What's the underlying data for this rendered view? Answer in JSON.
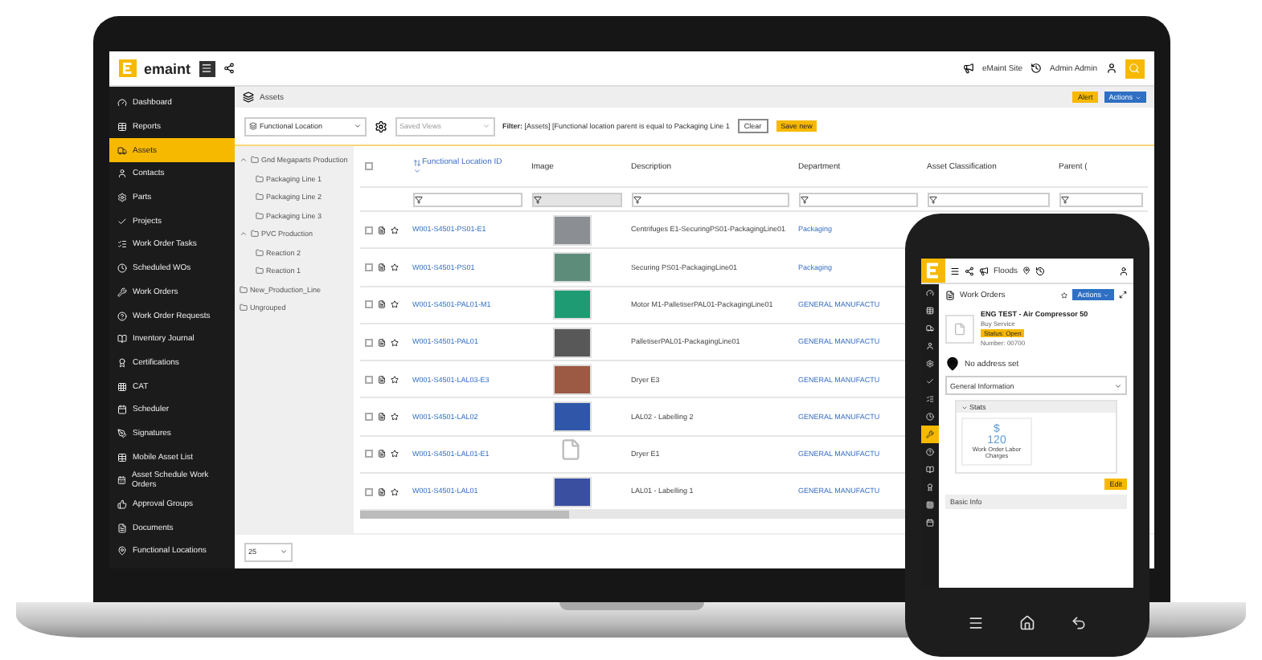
{
  "app": {
    "logo": "emaint",
    "site": "eMaint Site",
    "user": "Admin Admin"
  },
  "sidebar": [
    {
      "label": "Dashboard",
      "selected": false
    },
    {
      "label": "Reports",
      "selected": false
    },
    {
      "label": "Assets",
      "selected": true
    },
    {
      "label": "Contacts",
      "selected": false
    },
    {
      "label": "Parts",
      "selected": false
    },
    {
      "label": "Projects",
      "selected": false
    },
    {
      "label": "Work Order Tasks",
      "selected": false
    },
    {
      "label": "Scheduled WOs",
      "selected": false
    },
    {
      "label": "Work Orders",
      "selected": false
    },
    {
      "label": "Work Order Requests",
      "selected": false
    },
    {
      "label": "Inventory Journal",
      "selected": false
    },
    {
      "label": "Certifications",
      "selected": false
    },
    {
      "label": "CAT",
      "selected": false
    },
    {
      "label": "Scheduler",
      "selected": false
    },
    {
      "label": "Signatures",
      "selected": false
    },
    {
      "label": "Mobile Asset List",
      "selected": false
    },
    {
      "label": "Asset Schedule Work Orders",
      "selected": false
    },
    {
      "label": "Approval Groups",
      "selected": false
    },
    {
      "label": "Documents",
      "selected": false
    },
    {
      "label": "Functional Locations",
      "selected": false
    }
  ],
  "breadcrumb": "Assets",
  "page_buttons": {
    "alert": "Alert",
    "actions": "Actions"
  },
  "toolbar": {
    "view_select": "Functional Location",
    "saved_views_placeholder": "Saved Views",
    "filter": "**Filter:** [Assets] [Functional location parent is equal to Packaging Line 1",
    "clear": "Clear",
    "save": "Save new"
  },
  "tree": [
    {
      "label": "Gnd Megaparts Production",
      "expanded": true,
      "children": [
        {
          "label": "Packaging Line 1"
        },
        {
          "label": "Packaging Line 2"
        },
        {
          "label": "Packaging Line 3"
        }
      ]
    },
    {
      "label": "PVC Production",
      "expanded": true,
      "children": [
        {
          "label": "Reaction 2"
        },
        {
          "label": "Reaction 1"
        }
      ]
    },
    {
      "label": "New_Production_Line"
    },
    {
      "label": "Ungrouped"
    }
  ],
  "table": {
    "all_checked": false,
    "columns": [
      {
        "label": "Functional Location ID",
        "sorted": true
      },
      {
        "label": "Image",
        "sorted": false
      },
      {
        "label": "Description",
        "sorted": false
      },
      {
        "label": "Department",
        "sorted": false
      },
      {
        "label": "Asset Classification",
        "sorted": false
      },
      {
        "label": "Parent (",
        "sorted": false
      }
    ],
    "rows": [
      {
        "checked": false,
        "id": "W001-S4501-PS01-E1",
        "kind": "photo",
        "description": "Centrifuges E1-SecuringPS01-PackagingLine01",
        "department": "Packaging"
      },
      {
        "checked": false,
        "id": "W001-S4501-PS01",
        "kind": "photo",
        "description": "Securing PS01-PackagingLine01",
        "department": "Packaging"
      },
      {
        "checked": false,
        "id": "W001-S4501-PAL01-M1",
        "kind": "photo",
        "description": "Motor M1-PalletiserPAL01-PackagingLine01",
        "department": "GENERAL MANUFACTU"
      },
      {
        "checked": false,
        "id": "W001-S4501-PAL01",
        "kind": "photo",
        "description": "PalletiserPAL01-PackagingLine01",
        "department": "GENERAL MANUFACTU"
      },
      {
        "checked": false,
        "id": "W001-S4501-LAL03-E3",
        "kind": "photo",
        "description": "Dryer E3",
        "department": "GENERAL MANUFACTU"
      },
      {
        "checked": false,
        "id": "W001-S4501-LAL02",
        "kind": "photo",
        "description": "LAL02 - Labelling 2",
        "department": "GENERAL MANUFACTU"
      },
      {
        "checked": false,
        "id": "W001-S4501-LAL01-E1",
        "kind": "blank",
        "description": "Dryer E1",
        "department": "GENERAL MANUFACTU"
      },
      {
        "checked": false,
        "id": "W001-S4501-LAL01",
        "kind": "photo",
        "description": "LAL01 - Labelling 1",
        "department": "GENERAL MANUFACTU"
      }
    ]
  },
  "pagination": {
    "page_size": "25"
  },
  "phone": {
    "location": "Floods",
    "page_title": "Work Orders",
    "actions": "Actions",
    "record": {
      "title": "ENG TEST - Air Compressor 50",
      "subtitle": "Buy Service",
      "status": "Status: Open",
      "number": "Number: 00700"
    },
    "address": "No address set",
    "section_select": "General Information",
    "stats_title": "Stats",
    "stat": {
      "currency": "$",
      "value": "120",
      "label": "Work Order Labor Charges"
    },
    "edit": "Edit",
    "basic_info": "Basic Info",
    "menu": [
      {
        "selected": false
      },
      {
        "selected": false
      },
      {
        "selected": false
      },
      {
        "selected": false
      },
      {
        "selected": false
      },
      {
        "selected": false
      },
      {
        "selected": false
      },
      {
        "selected": false
      },
      {
        "selected": true
      },
      {
        "selected": false
      },
      {
        "selected": false
      },
      {
        "selected": false
      },
      {
        "selected": false
      },
      {
        "selected": false
      }
    ]
  }
}
